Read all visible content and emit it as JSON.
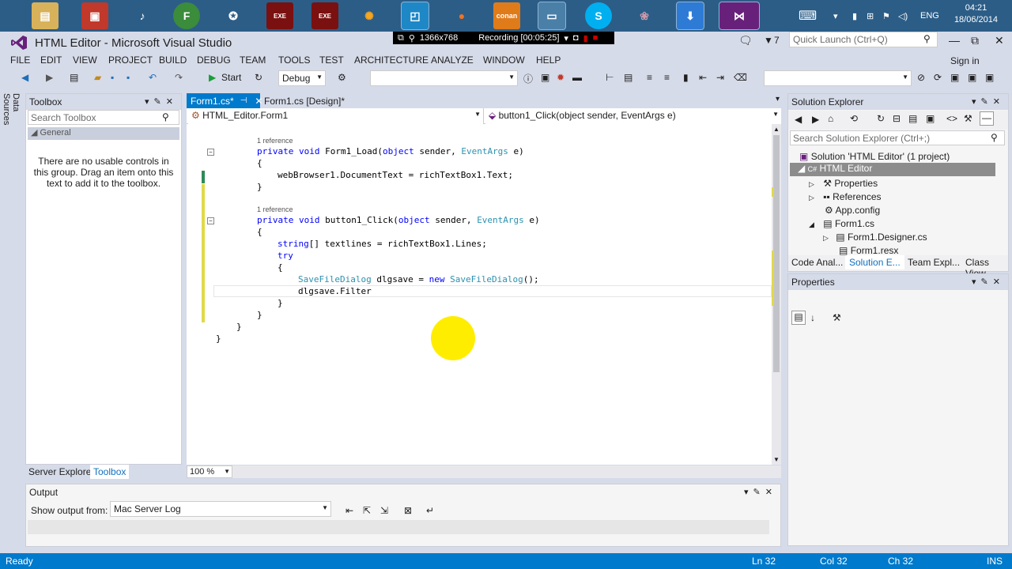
{
  "taskbar": {
    "clock_time": "04:21",
    "clock_date": "18/06/2014",
    "language": "ENG"
  },
  "recording": {
    "resolution": "1366x768",
    "status": "Recording [00:05:25]"
  },
  "window": {
    "title": "HTML Editor - Microsoft Visual Studio",
    "notifications_count": "7",
    "quick_launch_placeholder": "Quick Launch (Ctrl+Q)",
    "sign_in": "Sign in"
  },
  "menu": [
    "FILE",
    "EDIT",
    "VIEW",
    "PROJECT",
    "BUILD",
    "DEBUG",
    "TEAM",
    "TOOLS",
    "TEST",
    "ARCHITECTURE",
    "ANALYZE",
    "WINDOW",
    "HELP"
  ],
  "toolbar": {
    "start_label": "Start",
    "config_value": "Debug"
  },
  "side": {
    "data_sources": "Data Sources"
  },
  "toolbox": {
    "title": "Toolbox",
    "search_placeholder": "Search Toolbox",
    "group": "General",
    "empty_message": "There are no usable controls in this group. Drag an item onto this text to add it to the toolbox.",
    "bottom_tabs": [
      "Server Explorer",
      "Toolbox"
    ]
  },
  "editor": {
    "tabs": [
      "Form1.cs*",
      "Form1.cs [Design]*"
    ],
    "class_selector": "HTML_Editor.Form1",
    "member_selector": "button1_Click(object sender, EventArgs e)",
    "zoom": "100 %",
    "references_label": "1 reference",
    "lines": {
      "load_sig": "private void Form1_Load(object sender, EventArgs e)",
      "brace_open": "{",
      "load_body": "webBrowser1.DocumentText = richTextBox1.Text;",
      "brace_close": "}",
      "click_sig": "private void button1_Click(object sender, EventArgs e)",
      "textlines": "string[] textlines = richTextBox1.Lines;",
      "try_kw": "try",
      "dlg_new": "SaveFileDialog dlgsave = new SaveFileDialog();",
      "dlg_filter": "dlgsave.Filter"
    }
  },
  "solution_explorer": {
    "title": "Solution Explorer",
    "search_placeholder": "Search Solution Explorer (Ctrl+;)",
    "tree": [
      "Solution 'HTML Editor' (1 project)",
      "HTML Editor",
      "Properties",
      "References",
      "App.config",
      "Form1.cs",
      "Form1.Designer.cs",
      "Form1.resx"
    ],
    "tabs": [
      "Code Anal...",
      "Solution E...",
      "Team Expl...",
      "Class View"
    ]
  },
  "properties": {
    "title": "Properties"
  },
  "output": {
    "title": "Output",
    "show_from_label": "Show output from:",
    "source_value": "Mac Server Log"
  },
  "status": {
    "ready": "Ready",
    "ln": "Ln 32",
    "col": "Col 32",
    "ch": "Ch 32",
    "mode": "INS"
  },
  "colors": {
    "accent": "#007acc",
    "taskbar": "#2c5d87",
    "vs_purple": "#68217a",
    "cursor_highlight": "#ffed00"
  }
}
